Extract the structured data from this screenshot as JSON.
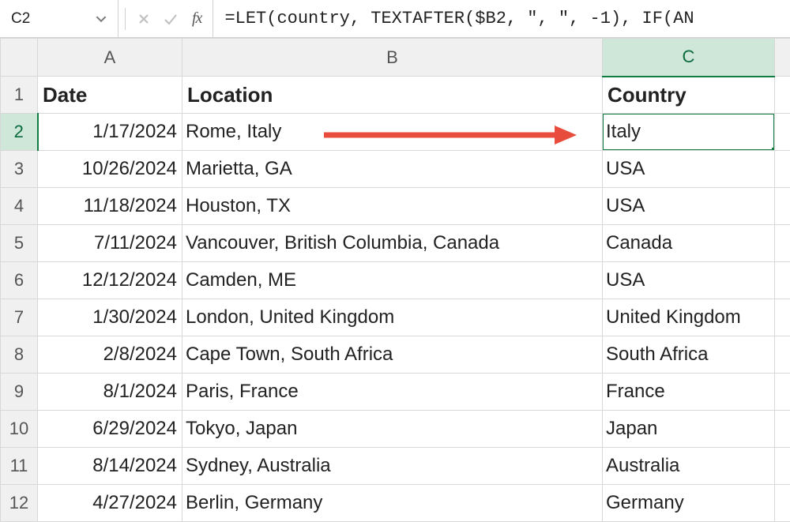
{
  "nameBox": "C2",
  "formula": "=LET(country, TEXTAFTER($B2, \", \", -1), IF(AN",
  "fxLabel": "fx",
  "columns": [
    "A",
    "B",
    "C"
  ],
  "headerRow": {
    "A": "Date",
    "B": "Location",
    "C": "Country"
  },
  "rows": [
    {
      "n": "1"
    },
    {
      "n": "2",
      "A": "1/17/2024",
      "B": "Rome, Italy",
      "C": "Italy"
    },
    {
      "n": "3",
      "A": "10/26/2024",
      "B": "Marietta, GA",
      "C": "USA"
    },
    {
      "n": "4",
      "A": "11/18/2024",
      "B": "Houston, TX",
      "C": "USA"
    },
    {
      "n": "5",
      "A": "7/11/2024",
      "B": "Vancouver, British Columbia, Canada",
      "C": "Canada"
    },
    {
      "n": "6",
      "A": "12/12/2024",
      "B": "Camden, ME",
      "C": "USA"
    },
    {
      "n": "7",
      "A": "1/30/2024",
      "B": "London, United Kingdom",
      "C": "United Kingdom"
    },
    {
      "n": "8",
      "A": "2/8/2024",
      "B": "Cape Town, South Africa",
      "C": "South Africa"
    },
    {
      "n": "9",
      "A": "8/1/2024",
      "B": "Paris, France",
      "C": "France"
    },
    {
      "n": "10",
      "A": "6/29/2024",
      "B": "Tokyo, Japan",
      "C": "Japan"
    },
    {
      "n": "11",
      "A": "8/14/2024",
      "B": "Sydney, Australia",
      "C": "Australia"
    },
    {
      "n": "12",
      "A": "4/27/2024",
      "B": "Berlin, Germany",
      "C": "Germany"
    }
  ],
  "selected": {
    "row": 2,
    "col": "C"
  },
  "colors": {
    "accent": "#107c41",
    "arrow": "#e74c3c"
  }
}
